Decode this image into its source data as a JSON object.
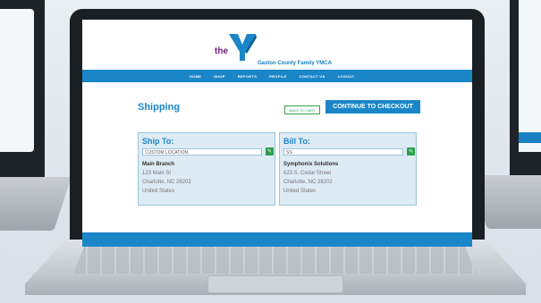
{
  "header": {
    "logo_small": "the",
    "org_name": "Gaston County Family YMCA"
  },
  "nav": {
    "items": [
      "HOME",
      "SHOP",
      "REPORTS",
      "PROFILE",
      "CONTACT US",
      "LOGOUT"
    ]
  },
  "shipping": {
    "title": "Shipping",
    "back_label": "BACK TO CART",
    "checkout_label": "CONTINUE TO CHECKOUT"
  },
  "ship_to": {
    "title": "Ship To:",
    "input_value": "CUSTOM LOCATION",
    "name": "Main Branch",
    "street": "123 Main St",
    "city": "Charlotte, NC  28202",
    "country": "United States"
  },
  "bill_to": {
    "title": "Bill To:",
    "input_value": "SS",
    "name": "Symphonix Solutions",
    "street": "623 S. Cedar Street",
    "city": "Charlotte, NC  28202",
    "country": "United States"
  },
  "colors": {
    "brand_blue": "#1a86c8",
    "edit_green": "#2aa04a",
    "logo_purple": "#6d2077"
  },
  "icons": {
    "edit": "pencil-icon",
    "logo": "ymca-y-logo"
  }
}
